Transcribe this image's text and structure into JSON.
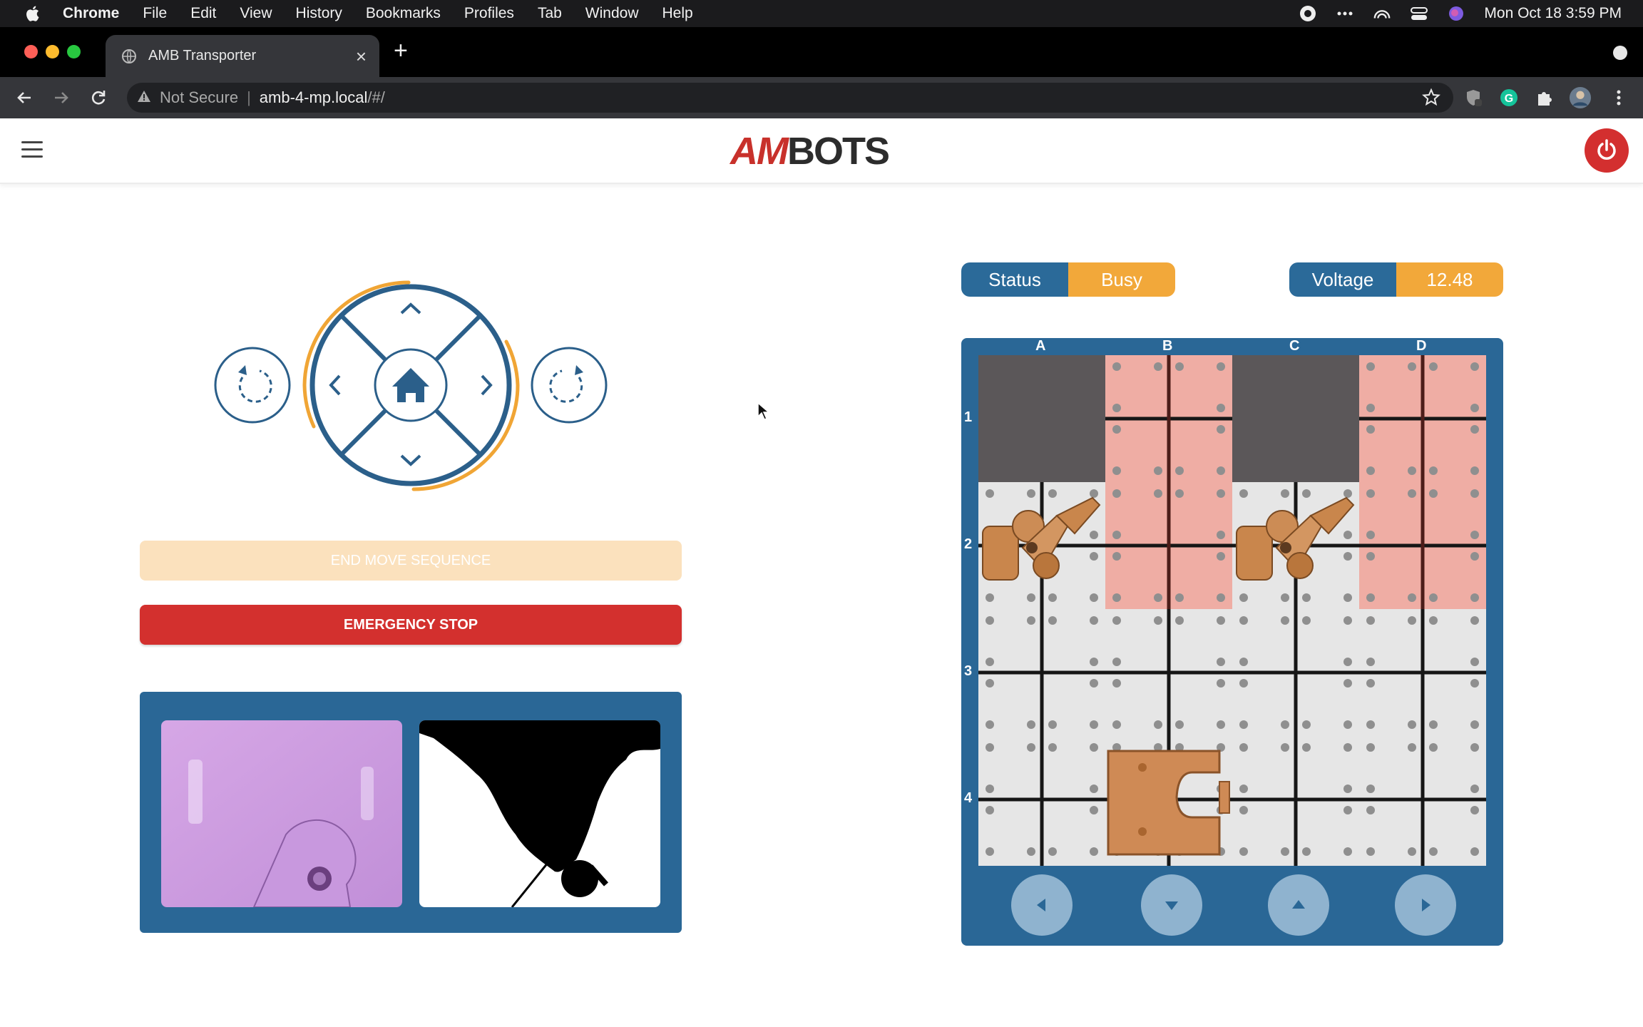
{
  "menubar": {
    "items": [
      "Chrome",
      "File",
      "Edit",
      "View",
      "History",
      "Bookmarks",
      "Profiles",
      "Tab",
      "Window",
      "Help"
    ],
    "clock": "Mon Oct 18  3:59 PM"
  },
  "browser": {
    "tab_title": "AMB Transporter",
    "security_label": "Not Secure",
    "url_host": "amb-4-mp.local",
    "url_path": "/#/"
  },
  "app": {
    "logo_left": "AM",
    "logo_right": "BOTS",
    "end_sequence_label": "END MOVE SEQUENCE",
    "emergency_stop_label": "EMERGENCY STOP",
    "status_label": "Status",
    "status_value": "Busy",
    "voltage_label": "Voltage",
    "voltage_value": "12.48"
  },
  "board": {
    "columns": [
      "A",
      "B",
      "C",
      "D"
    ],
    "rows": [
      "1",
      "2",
      "3",
      "4"
    ]
  },
  "colors": {
    "primary": "#2b6a99",
    "accent": "#f2a83a",
    "danger": "#d3302e"
  }
}
